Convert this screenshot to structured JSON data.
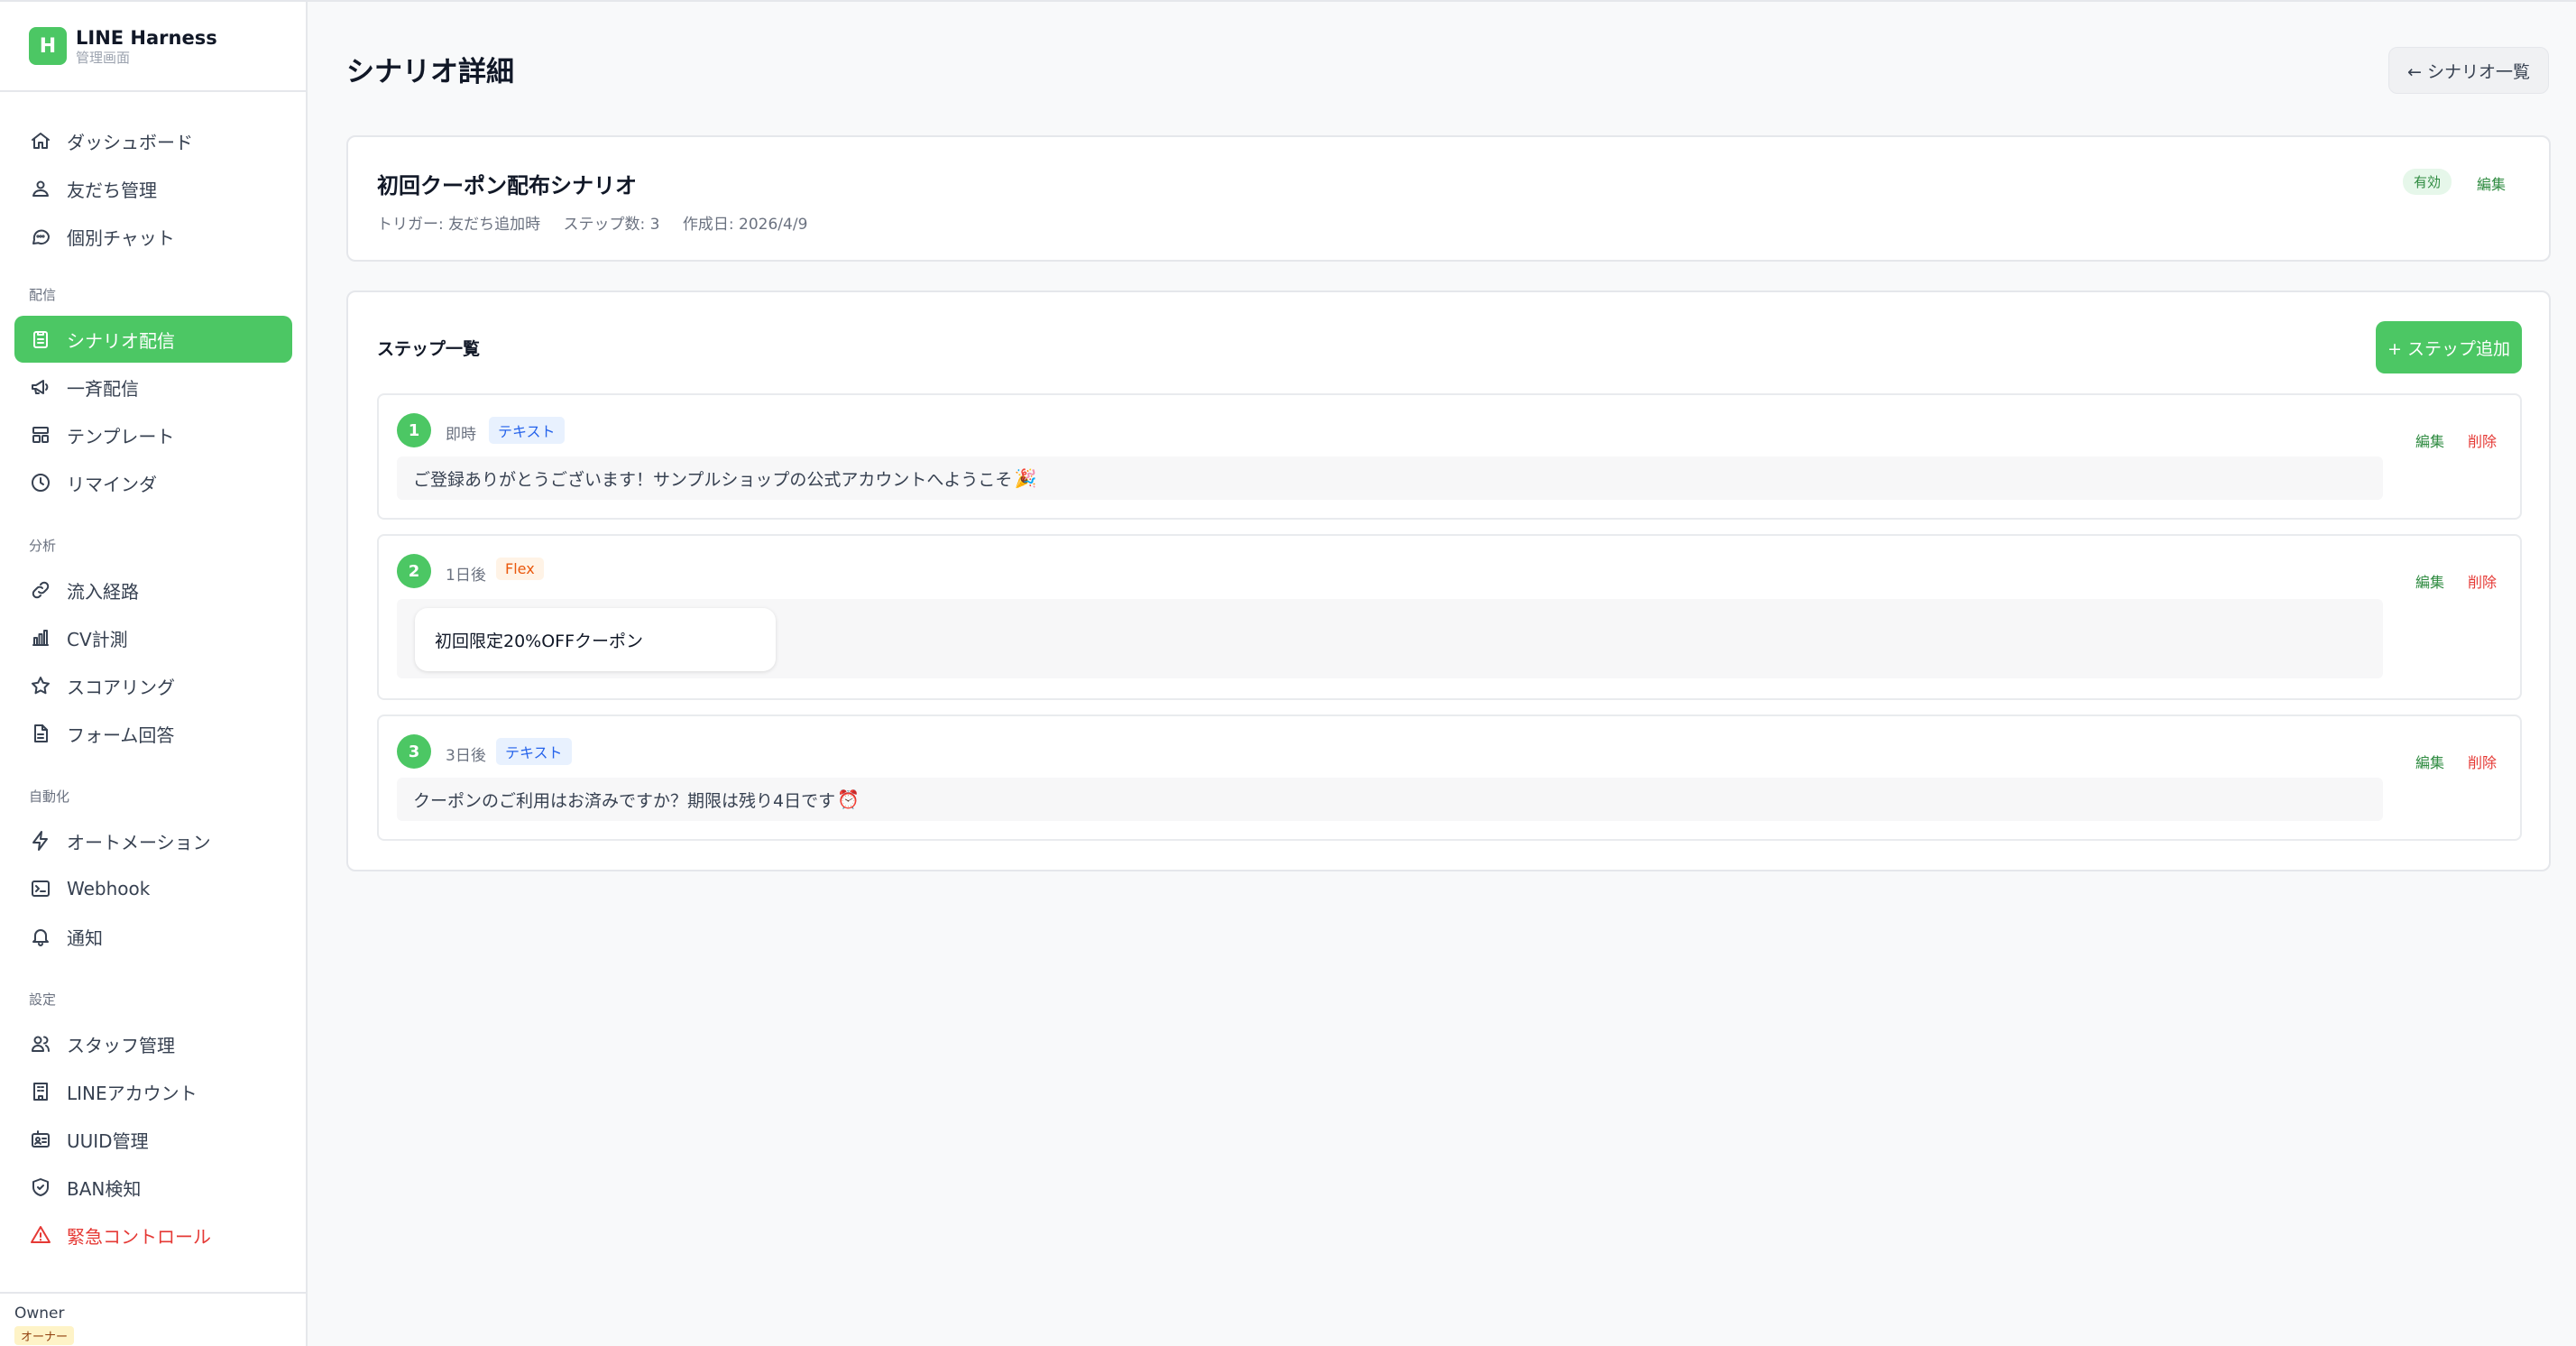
{
  "brand": {
    "logo_letter": "H",
    "name": "LINE Harness",
    "subtitle": "管理画面"
  },
  "nav": {
    "items_top": [
      {
        "label": "ダッシュボード",
        "icon": "home-icon"
      },
      {
        "label": "友だち管理",
        "icon": "users-icon"
      },
      {
        "label": "個別チャット",
        "icon": "chat-icon"
      }
    ],
    "sections": [
      {
        "title": "配信",
        "items": [
          {
            "label": "シナリオ配信",
            "icon": "clipboard-icon",
            "active": true
          },
          {
            "label": "一斉配信",
            "icon": "megaphone-icon"
          },
          {
            "label": "テンプレート",
            "icon": "layout-icon"
          },
          {
            "label": "リマインダ",
            "icon": "clock-icon"
          }
        ]
      },
      {
        "title": "分析",
        "items": [
          {
            "label": "流入経路",
            "icon": "link-icon"
          },
          {
            "label": "CV計測",
            "icon": "bar-chart-icon"
          },
          {
            "label": "スコアリング",
            "icon": "star-icon"
          },
          {
            "label": "フォーム回答",
            "icon": "document-icon"
          }
        ]
      },
      {
        "title": "自動化",
        "items": [
          {
            "label": "オートメーション",
            "icon": "bolt-icon"
          },
          {
            "label": "Webhook",
            "icon": "terminal-icon"
          },
          {
            "label": "通知",
            "icon": "bell-icon"
          }
        ]
      },
      {
        "title": "設定",
        "items": [
          {
            "label": "スタッフ管理",
            "icon": "staff-icon"
          },
          {
            "label": "LINEアカウント",
            "icon": "building-icon"
          },
          {
            "label": "UUID管理",
            "icon": "id-card-icon"
          },
          {
            "label": "BAN検知",
            "icon": "shield-icon"
          },
          {
            "label": "緊急コントロール",
            "icon": "warning-icon",
            "danger": true
          }
        ]
      }
    ]
  },
  "user": {
    "name": "Owner",
    "role": "オーナー"
  },
  "header": {
    "title": "シナリオ詳細",
    "back_label": "← シナリオ一覧"
  },
  "scenario": {
    "title": "初回クーポン配布シナリオ",
    "trigger": "トリガー: 友だち追加時",
    "step_count": "ステップ数: 3",
    "created": "作成日: 2026/4/9",
    "status": "有効",
    "edit_label": "編集"
  },
  "steps_section": {
    "title": "ステップ一覧",
    "add_label": "+ ステップ追加",
    "edit_label": "編集",
    "delete_label": "削除"
  },
  "steps": [
    {
      "number": "1",
      "delay": "即時",
      "type": "テキスト",
      "content": "ご登録ありがとうございます！サンプルショップの公式アカウントへようこそ",
      "emoji": "🎉"
    },
    {
      "number": "2",
      "delay": "1日後",
      "type": "Flex",
      "content": "初回限定20%OFFクーポン"
    },
    {
      "number": "3",
      "delay": "3日後",
      "type": "テキスト",
      "content": "クーポンのご利用はお済みですか？期限は残り4日です",
      "emoji": "⏰"
    }
  ],
  "colors": {
    "accent": "#4cc764",
    "danger": "#e53935",
    "edit": "#2e8b40"
  }
}
